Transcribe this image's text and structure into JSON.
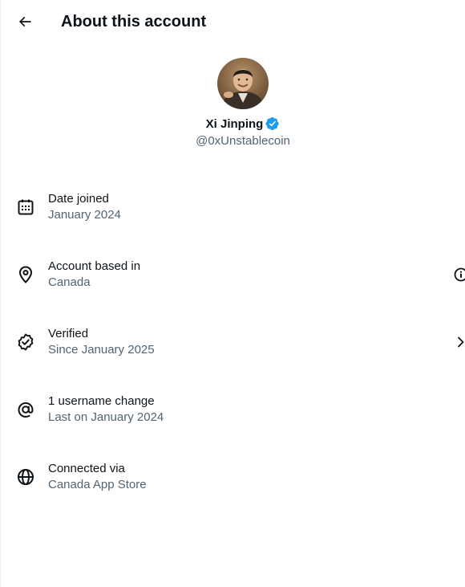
{
  "header": {
    "title": "About this account",
    "back_icon": "arrow-left-icon"
  },
  "profile": {
    "display_name": "Xi Jinping",
    "handle": "@0xUnstablecoin",
    "verified_badge_color": "#1d9bf0",
    "avatar_icon": "avatar-photo"
  },
  "details": [
    {
      "icon": "calendar-icon",
      "label": "Date joined",
      "value": "January 2024",
      "trailing": ""
    },
    {
      "icon": "location-pin-icon",
      "label": "Account based in",
      "value": "Canada",
      "trailing": "info-icon"
    },
    {
      "icon": "verified-seal-icon",
      "label": "Verified",
      "value": "Since January 2025",
      "trailing": "chevron-right-icon"
    },
    {
      "icon": "at-sign-icon",
      "label": "1 username change",
      "value": "Last on January 2024",
      "trailing": ""
    },
    {
      "icon": "globe-icon",
      "label": "Connected via",
      "value": "Canada App Store",
      "trailing": ""
    }
  ],
  "colors": {
    "primary_text": "#0f1419",
    "secondary_text": "#536471",
    "accent": "#1d9bf0"
  }
}
